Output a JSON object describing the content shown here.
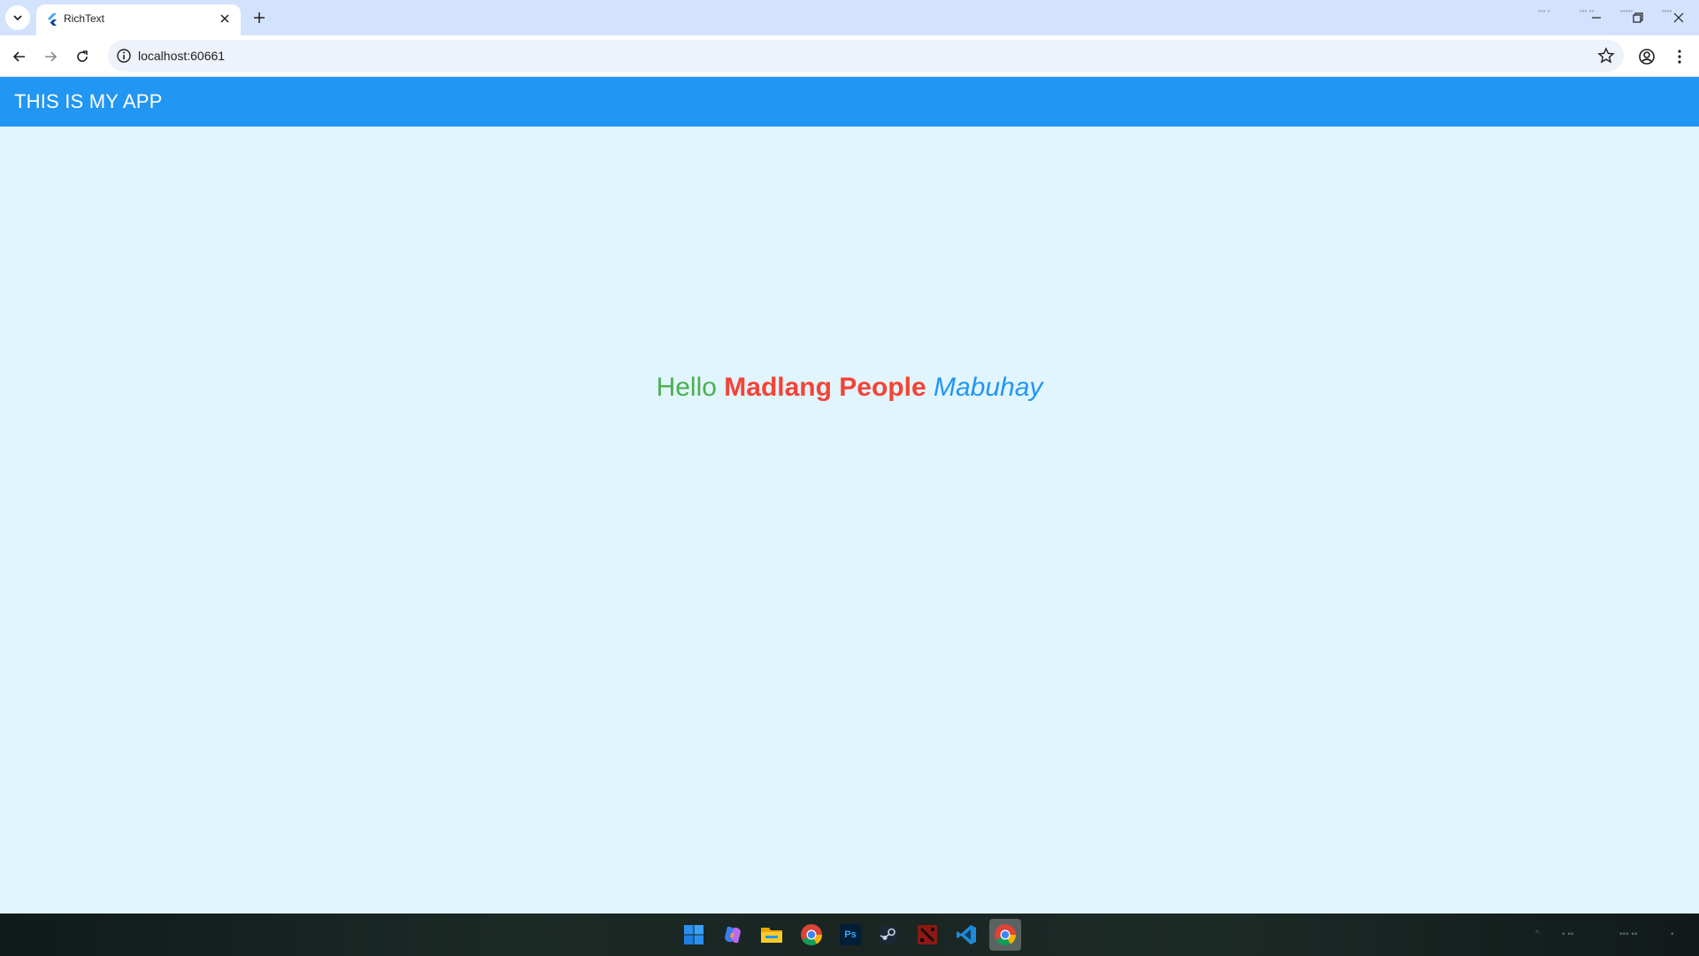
{
  "browser": {
    "tab_title": "RichText",
    "url": "localhost:60661",
    "icons": [
      "tab-search-icon",
      "flutter-icon",
      "close-icon",
      "plus-icon",
      "back-icon",
      "forward-icon",
      "reload-icon",
      "info-icon",
      "star-icon",
      "profile-icon",
      "menu-icon",
      "minimize-icon",
      "restore-icon",
      "close-window-icon"
    ]
  },
  "app": {
    "title": "THIS IS MY APP",
    "bar_color": "#2196f3",
    "background_color": "#e1f5fe"
  },
  "rich_text": {
    "part1": "Hello ",
    "part1_color": "#4caf50",
    "part2": "Madlang People",
    "part2_color": "#f44336",
    "part3": "Mabuhay",
    "part3_color": "#2196f3"
  },
  "taskbar": {
    "icons": [
      "windows-start-icon",
      "copilot-icon",
      "file-explorer-icon",
      "chrome-icon",
      "photoshop-icon",
      "steam-icon",
      "dota-icon",
      "vscode-icon",
      "chrome-active-icon"
    ],
    "photoshop_label": "Ps"
  }
}
